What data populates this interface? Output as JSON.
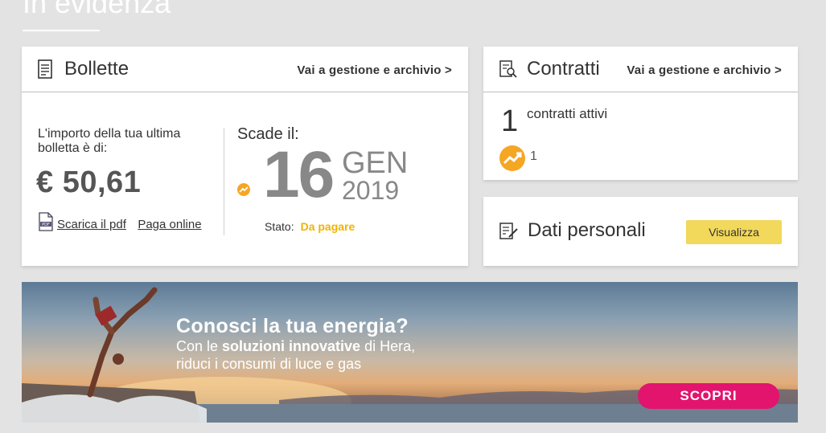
{
  "page": {
    "title": "In evidenza"
  },
  "bollette": {
    "title": "Bollette",
    "link": "Vai a gestione e archivio >",
    "amount_label": "L'importo della tua ultima bolletta è di:",
    "amount": "€ 50,61",
    "download_pdf": "Scarica il pdf",
    "pay_online": "Paga online",
    "due_label": "Scade il:",
    "due_day": "16",
    "due_month": "GEN",
    "due_year": "2019",
    "status_label": "Stato:",
    "status_value": "Da pagare"
  },
  "contratti": {
    "title": "Contratti",
    "link": "Vai a gestione e archivio >",
    "count": "1",
    "label": "contratti attivi",
    "energy_count": "1"
  },
  "dati_personali": {
    "title": "Dati personali",
    "button": "Visualizza"
  },
  "banner": {
    "headline": "Conosci la tua energia?",
    "line1_prefix": "Con le ",
    "line1_bold": "soluzioni innovative",
    "line1_suffix": " di Hera,",
    "line2": "riduci i consumi di luce e gas",
    "cta": "SCOPRI"
  },
  "colors": {
    "accent_yellow": "#f2d85b",
    "status_orange": "#f0b400",
    "cta_pink": "#e2146e"
  },
  "icons": [
    "document-icon",
    "contract-search-icon",
    "energy-trend-icon",
    "pdf-icon",
    "edit-document-icon"
  ]
}
